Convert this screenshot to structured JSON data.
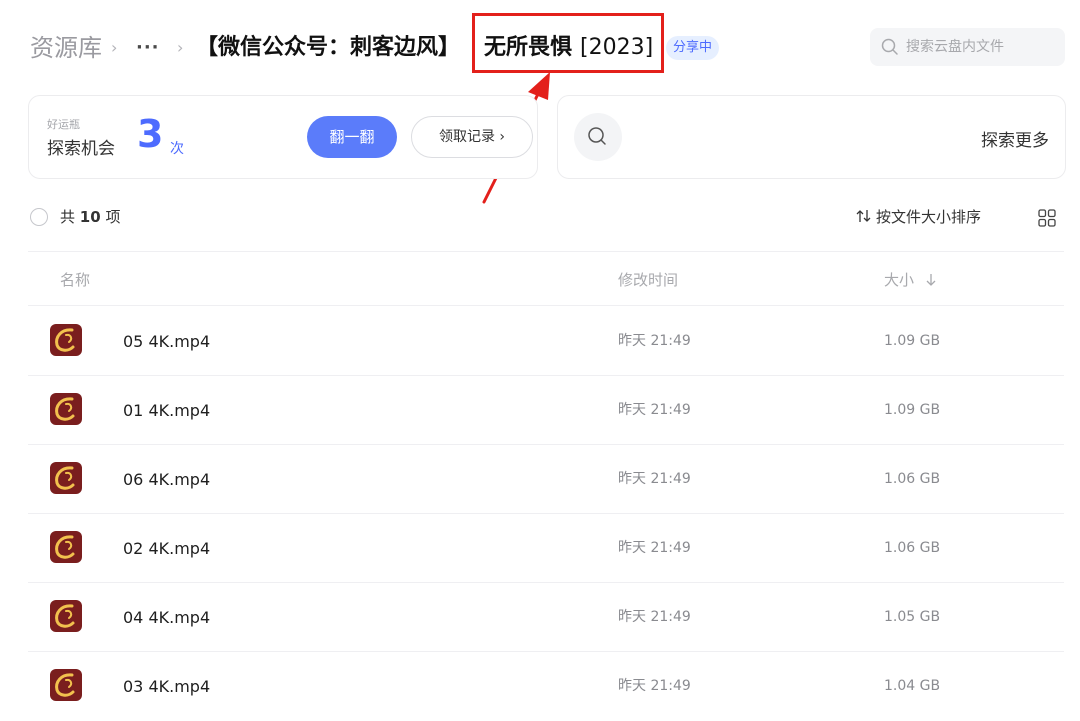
{
  "breadcrumb": {
    "root": "资源库",
    "sep1": "›",
    "ellipsis": "···",
    "sep2": "›",
    "title_prefix": "【微信公众号：刺客边风】",
    "title_main": "无所畏惧",
    "title_year": "[2023]",
    "share_badge": "分享中"
  },
  "search": {
    "placeholder": "搜索云盘内文件"
  },
  "luck_card": {
    "small_label": "好运瓶",
    "label": "探索机会",
    "count": "3",
    "unit": "次",
    "flip_button": "翻一翻",
    "record_button": "领取记录 ›"
  },
  "explore_card": {
    "label": "探索更多"
  },
  "toolbar": {
    "count_prefix": "共",
    "count_value": "10",
    "count_suffix": "项",
    "sort_label": "按文件大小排序"
  },
  "columns": {
    "name": "名称",
    "modified": "修改时间",
    "size": "大小"
  },
  "files": [
    {
      "name": "05 4K.mp4",
      "modified": "昨天 21:49",
      "size": "1.09 GB"
    },
    {
      "name": "01 4K.mp4",
      "modified": "昨天 21:49",
      "size": "1.09 GB"
    },
    {
      "name": "06 4K.mp4",
      "modified": "昨天 21:49",
      "size": "1.06 GB"
    },
    {
      "name": "02 4K.mp4",
      "modified": "昨天 21:49",
      "size": "1.06 GB"
    },
    {
      "name": "04 4K.mp4",
      "modified": "昨天 21:49",
      "size": "1.05 GB"
    },
    {
      "name": "03 4K.mp4",
      "modified": "昨天 21:49",
      "size": "1.04 GB"
    }
  ],
  "colors": {
    "accent": "#4d6bfe",
    "highlight": "#e3201b",
    "video_icon_bg": "#7a1e1e",
    "video_icon_swirl": "#f2c14e"
  },
  "icons": {
    "search": "search-icon",
    "explore": "search-icon",
    "sort": "sort-arrows-icon",
    "size_sort": "arrow-down-icon",
    "view": "grid-view-icon",
    "file": "video-file-icon"
  }
}
